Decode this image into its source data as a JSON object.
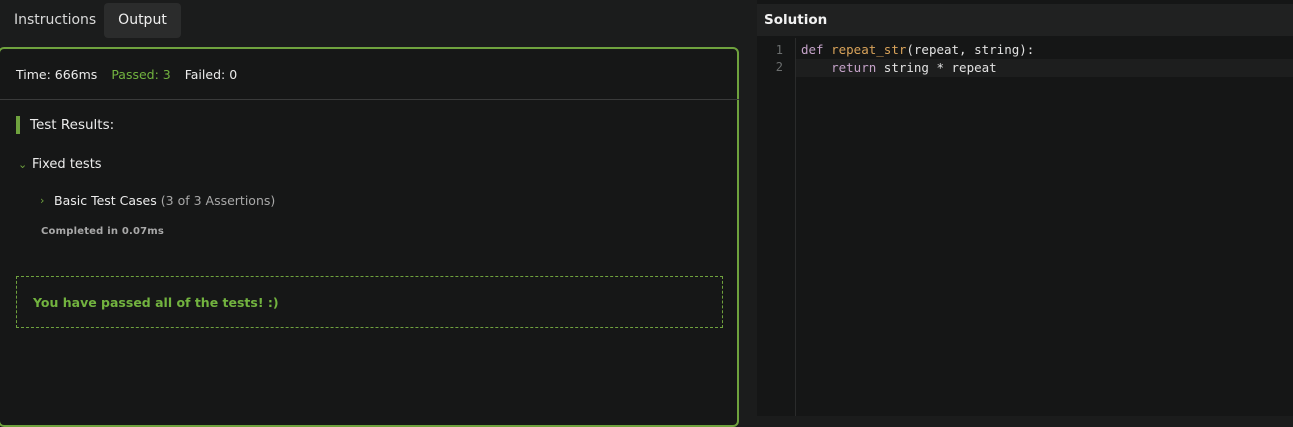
{
  "tabs": [
    {
      "label": "Instructions"
    },
    {
      "label": "Output"
    }
  ],
  "output": {
    "time": "Time: 666ms",
    "passed": "Passed: 3",
    "failed": "Failed: 0",
    "results_title": "Test Results:",
    "group_label": "Fixed tests",
    "case_label": "Basic Test Cases",
    "case_detail": "(3 of 3 Assertions)",
    "completed": "Completed in 0.07ms",
    "success_message": "You have passed all of the tests! :)"
  },
  "solution": {
    "title": "Solution",
    "line_numbers": [
      "1",
      "2"
    ],
    "line1": {
      "kw": "def",
      "fn": "repeat_str",
      "rest": "(repeat, string):"
    },
    "line2": {
      "indent": "    ",
      "kw": "return",
      "rest": " string * repeat"
    }
  },
  "colors": {
    "accent": "#6fa23e",
    "success_text": "#72b33f"
  }
}
